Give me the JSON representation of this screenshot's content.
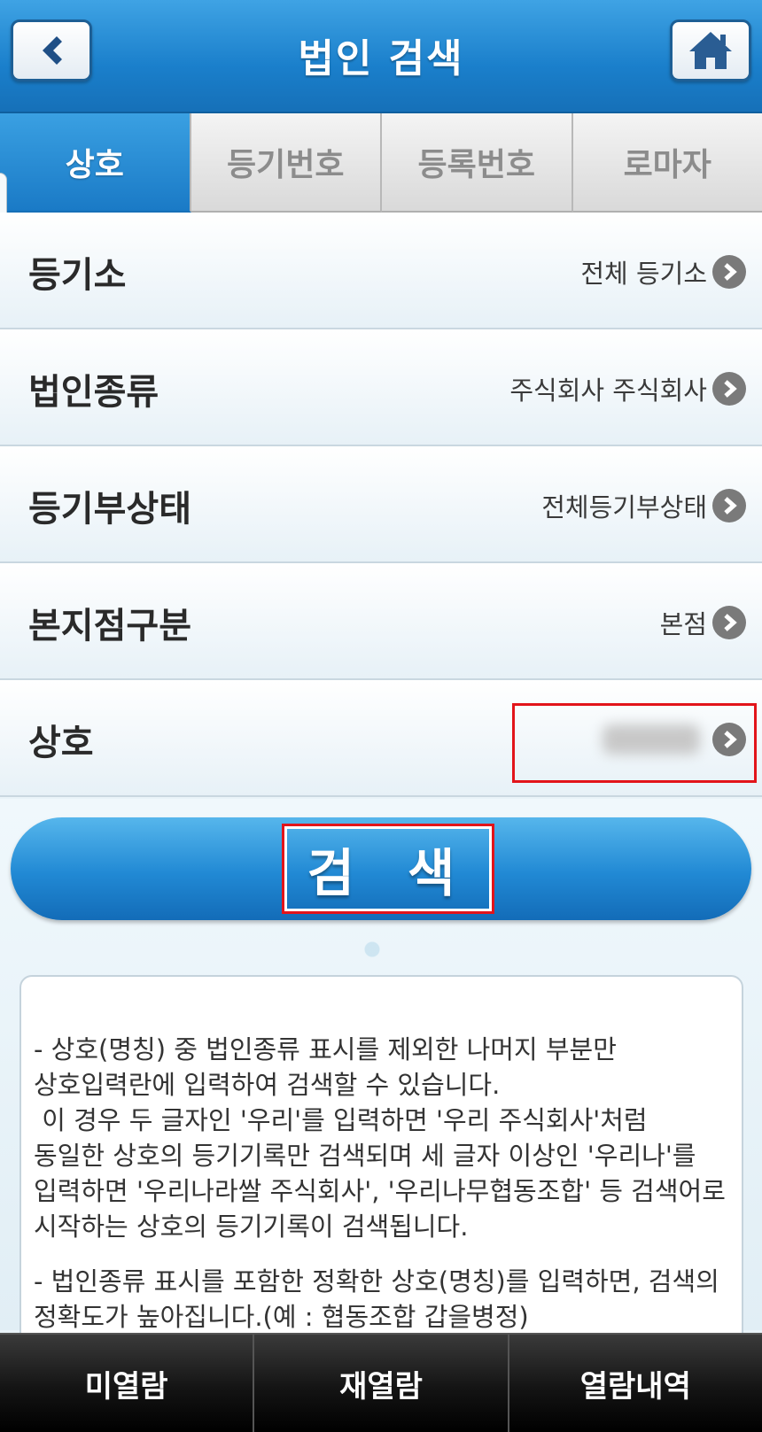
{
  "header": {
    "title": "법인 검색",
    "back_icon": "chevron-left-icon",
    "home_icon": "home-icon"
  },
  "tabs": [
    {
      "label": "상호",
      "active": true
    },
    {
      "label": "등기번호",
      "active": false
    },
    {
      "label": "등록번호",
      "active": false
    },
    {
      "label": "로마자",
      "active": false
    }
  ],
  "rows": [
    {
      "label": "등기소",
      "value": "전체 등기소"
    },
    {
      "label": "법인종류",
      "value": "주식회사 주식회사"
    },
    {
      "label": "등기부상태",
      "value": "전체등기부상태"
    },
    {
      "label": "본지점구분",
      "value": "본점"
    },
    {
      "label": "상호",
      "value": ""
    }
  ],
  "search_button": {
    "label": "검색"
  },
  "info": {
    "p1": "- 상호(명칭) 중 법인종류 표시를 제외한 나머지 부분만 상호입력란에 입력하여 검색할 수 있습니다.\n 이 경우 두 글자인 '우리'를 입력하면 '우리 주식회사'처럼 동일한 상호의 등기기록만 검색되며 세 글자 이상인 '우리나'를 입력하면 '우리나라쌀 주식회사', '우리나무협동조합' 등 검색어로 시작하는 상호의 등기기록이 검색됩니다.",
    "p2": "- 법인종류 표시를 포함한 정확한 상호(명칭)를 입력하면, 검색의 정확도가 높아집니다.(예 : 협동조합 갑을병정)"
  },
  "bottom_nav": [
    {
      "label": "미열람"
    },
    {
      "label": "재열람"
    },
    {
      "label": "열람내역"
    }
  ],
  "colors": {
    "header_blue": "#1a7fcb",
    "highlight_red": "#e2141a",
    "nav_black": "#141414"
  }
}
